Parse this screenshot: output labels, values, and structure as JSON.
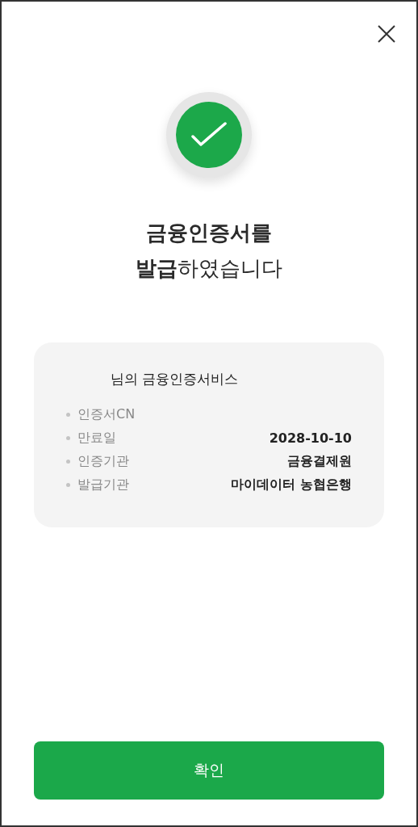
{
  "title": {
    "line_1": "금융인증서를",
    "line_2": "**발급**하였습니다"
  },
  "card": {
    "heading": "님의 금융인증서비스",
    "rows": [
      {
        "label": "인증서CN"
      },
      {
        "label": "만료일",
        "value": "2028-10-10"
      },
      {
        "label": "인증기관",
        "value": "금융결제원"
      },
      {
        "label": "발급기관",
        "value": "마이데이터 농협은행"
      }
    ]
  },
  "confirm_button": "확인"
}
